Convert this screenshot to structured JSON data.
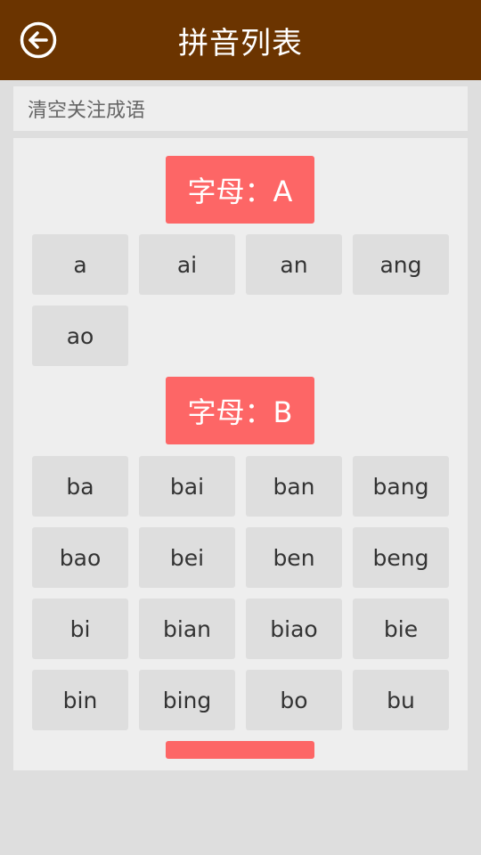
{
  "header": {
    "title": "拼音列表",
    "back_icon": "arrow-left-circle-icon",
    "bg_color": "#6b3400"
  },
  "clear_bar": {
    "label": "清空关注成语"
  },
  "accent_color": "#fd6666",
  "groups": [
    {
      "heading": "字母：A",
      "items": [
        "a",
        "ai",
        "an",
        "ang",
        "ao"
      ]
    },
    {
      "heading": "字母：B",
      "items": [
        "ba",
        "bai",
        "ban",
        "bang",
        "bao",
        "bei",
        "ben",
        "beng",
        "bi",
        "bian",
        "biao",
        "bie",
        "bin",
        "bing",
        "bo",
        "bu"
      ]
    }
  ]
}
